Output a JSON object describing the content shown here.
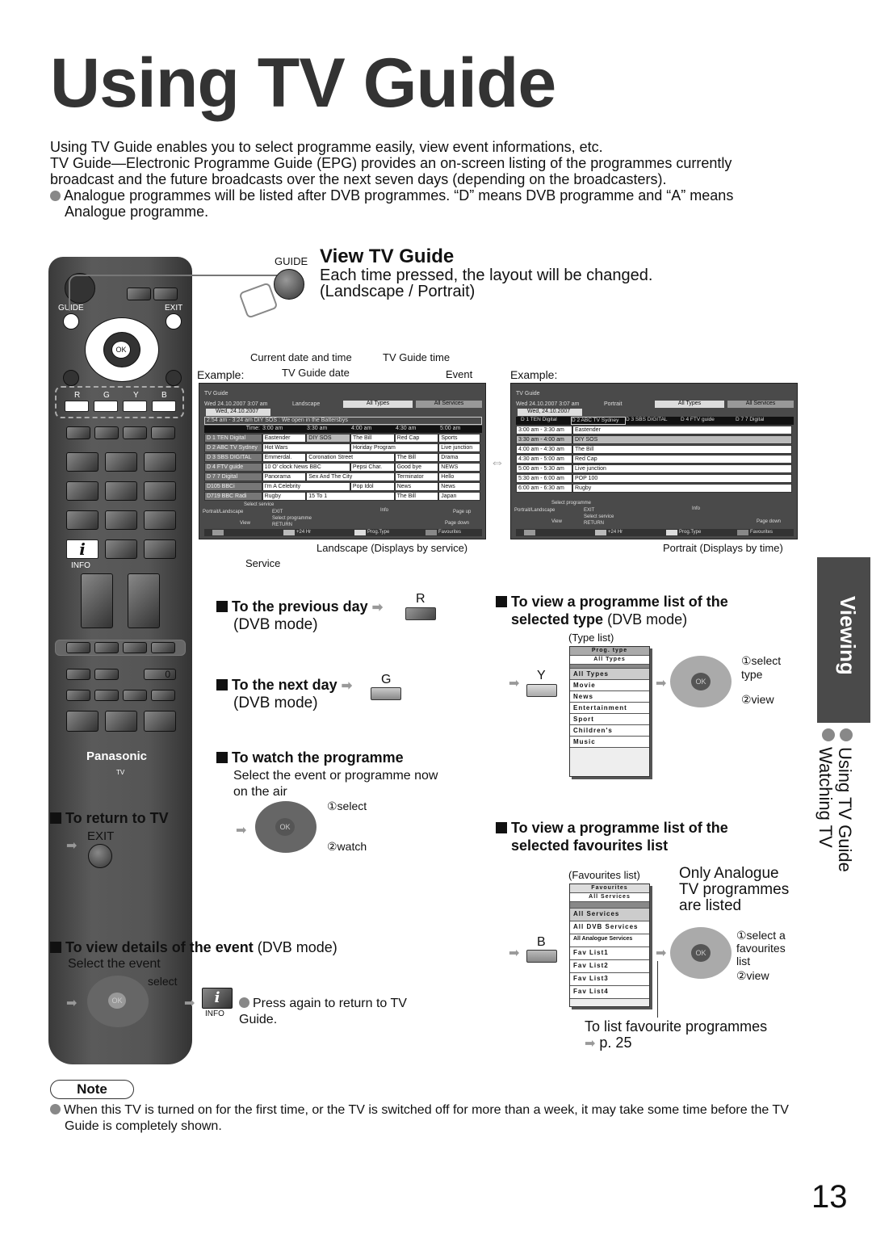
{
  "title": "Using TV Guide",
  "intro": {
    "p1": "Using TV Guide enables you to select programme easily, view event informations, etc.",
    "p2": "TV Guide—Electronic Programme Guide (EPG) provides an on-screen listing of the programmes currently broadcast and the future broadcasts over the next seven days (depending on the broadcasters).",
    "bullet": "Analogue programmes will be listed after DVB programmes. “D” means DVB programme and “A” means Analogue programme."
  },
  "remote": {
    "guide": "GUIDE",
    "exit": "EXIT",
    "ok": "OK",
    "r": "R",
    "g": "G",
    "y": "Y",
    "b": "B",
    "info_glyph": "i",
    "info": "INFO",
    "zero": "0",
    "brand": "Panasonic",
    "tv": "TV"
  },
  "view_guide": {
    "button": "GUIDE",
    "heading": "View TV Guide",
    "line1": "Each time pressed, the layout will be changed.",
    "line2": "(Landscape / Portrait)"
  },
  "callouts": {
    "current_date_time": "Current date and time",
    "guide_time": "TV Guide time",
    "example": "Example:",
    "guide_date": "TV Guide date",
    "event": "Event",
    "service": "Service",
    "landscape_caption": "Landscape (Displays by service)",
    "portrait_caption": "Portrait (Displays by time)"
  },
  "landscape": {
    "title": "TV Guide",
    "datetime": "Wed 24.10.2007 3:07 am",
    "mode": "Landscape",
    "types": "All Types",
    "services": "All Services",
    "date_tab": "Wed, 24.10.2007",
    "info_bar": "2:54 am - 3:24 am  DIY SOS : We open in the Battersbys",
    "time_label": "Time:",
    "times": [
      "3:00 am",
      "3:30 am",
      "4:00 am",
      "4:30 am",
      "5:00 am"
    ],
    "rows": [
      {
        "ch": "D   1  TEN Digital",
        "progs": [
          "Eastender",
          "DIY SOS",
          "The Bill",
          "Red Cap",
          "Sports"
        ]
      },
      {
        "ch": "D   2   ABC TV Sydney",
        "progs": [
          "Hot Wars",
          "Horiday Program",
          "Live junction"
        ]
      },
      {
        "ch": "D   3  SBS DIGITAL",
        "progs": [
          "Emmerdal.",
          "Coronation Street",
          "The Bill",
          "Drama"
        ]
      },
      {
        "ch": "D   4   FTV guide",
        "progs": [
          "10 O' clock News BBC",
          "Pepsi Char.",
          "Good bye",
          "NEWS"
        ]
      },
      {
        "ch": "D   7   7 Digital",
        "progs": [
          "Panorama",
          "Sex And The City",
          "Terminator",
          "Hello"
        ]
      },
      {
        "ch": "D105  BBCi",
        "progs": [
          "I'm A Celebrity",
          "Pop Idol",
          "News",
          "News"
        ]
      },
      {
        "ch": "D719  BBC Radi",
        "progs": [
          "Rugby",
          "15 To 1",
          "The Bill",
          "Japan"
        ]
      }
    ],
    "footer": {
      "select_service": "Select service",
      "portrait_landscape": "Portrait/Landscape",
      "exit": "EXIT",
      "select_programme": "Select programme",
      "view": "View",
      "return": "RETURN",
      "info": "Info",
      "page_up": "Page up",
      "page_down": "Page down",
      "plus24": "+24 Hr",
      "prog_type": "Prog.Type",
      "favourites": "Favourites"
    }
  },
  "portrait": {
    "title": "TV Guide",
    "datetime": "Wed 24.10.2007 3:07 am",
    "mode": "Portrait",
    "types": "All Types",
    "services": "All Services",
    "date_tab": "Wed, 24.10.2007",
    "channels": [
      "D    1 TEN Digital",
      "D    2 ABC TV Sydney",
      "D    3 SBS DIGITAL",
      "D    4 FTV guide",
      "D    7 7 Digital"
    ],
    "rows": [
      {
        "time": "3:00 am - 3:30 am",
        "prog": "Eastender"
      },
      {
        "time": "3:30 am - 4:00 am",
        "prog": "DIY SOS"
      },
      {
        "time": "4:00 am - 4:30 am",
        "prog": "The Bill"
      },
      {
        "time": "4:30 am - 5:00 am",
        "prog": "Red Cap"
      },
      {
        "time": "5:00 am - 5:30 am",
        "prog": "Live junction"
      },
      {
        "time": "5:30 am - 6:00 am",
        "prog": "POP 100"
      },
      {
        "time": "6:00 am - 6:30 am",
        "prog": "Rugby"
      }
    ],
    "footer": {
      "select_programme": "Select programme",
      "portrait_landscape": "Portrait/Landscape",
      "exit": "EXIT",
      "select_service": "Select service",
      "view": "View",
      "return": "RETURN",
      "info": "Info",
      "page_down": "Page down",
      "plus24": "+24 Hr",
      "prog_type": "Prog.Type",
      "favourites": "Favourites"
    }
  },
  "sections": {
    "prev_day": {
      "title": "To the previous day",
      "mode": "(DVB mode)",
      "key": "R"
    },
    "next_day": {
      "title": "To the next day",
      "mode": "(DVB mode)",
      "key": "G"
    },
    "watch": {
      "title": "To watch the programme",
      "desc": "Select the event or programme now on the air",
      "step1": "①select",
      "step2": "②watch"
    },
    "return_tv": {
      "title": "To return to TV",
      "key": "EXIT"
    },
    "details": {
      "title": "To view details of the event",
      "mode": "(DVB mode)",
      "desc": "Select the event",
      "select": "select",
      "info": "INFO",
      "note": "Press again to return to TV Guide."
    },
    "type": {
      "title_bold": "To view a programme list of the selected type",
      "mode": "(DVB mode)",
      "key": "Y",
      "caption": "(Type list)",
      "header1": "Prog. type",
      "header2": "All Types",
      "items": [
        "All Types",
        "Movie",
        "News",
        "Entertainment",
        "Sport",
        "Children's",
        "Music"
      ],
      "step1": "①select type",
      "step2": "②view"
    },
    "fav": {
      "title_bold": "To view a programme list of the selected favourites list",
      "key": "B",
      "caption": "(Favourites list)",
      "header1": "Favourites",
      "header2": "All Services",
      "items": [
        "All Services",
        "All DVB Services",
        "All Analogue Services",
        "Fav List1",
        "Fav List2",
        "Fav List3",
        "Fav List4"
      ],
      "analogue_note": "Only Analogue TV programmes are listed",
      "step1": "①select a favourites list",
      "step2": "②view",
      "fav_note": "To list favourite programmes",
      "page_ref": "p. 25"
    }
  },
  "sidebar": {
    "tab": "Viewing",
    "item1": "Using TV Guide",
    "item2": "Watching TV"
  },
  "note": {
    "label": "Note",
    "text": "When this TV is turned on for the first time, or the TV is switched off for more than a week, it may take some time before the TV Guide is completely shown."
  },
  "page_number": "13"
}
